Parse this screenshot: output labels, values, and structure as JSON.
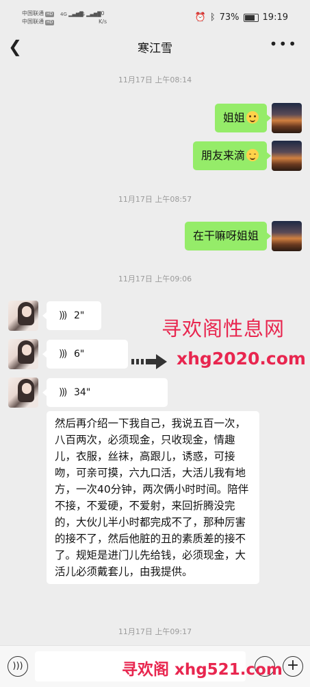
{
  "status_bar": {
    "carrier1": "中国联通",
    "carrier2": "中国联通",
    "hd": "HD",
    "net1": "4G",
    "net2": "5G",
    "speed_value": "0",
    "speed_unit": "K/s",
    "battery": "73%",
    "time": "19:19"
  },
  "header": {
    "title": "寒江雪"
  },
  "timestamps": [
    "11月17日 上午08:14",
    "11月17日 上午08:57",
    "11月17日 上午09:06",
    "11月17日 上午09:17"
  ],
  "messages_out": [
    {
      "text": "姐姐"
    },
    {
      "text": "朋友来滴"
    },
    {
      "text": "在干嘛呀姐姐"
    }
  ],
  "voice_messages": [
    {
      "duration": "2\""
    },
    {
      "duration": "6\""
    },
    {
      "duration": "34\""
    }
  ],
  "long_message": "然后再介绍一下我自己，我说五百一次，八百两次，必须现金，只收现金，情趣儿，衣服，丝袜，高跟儿，诱惑，可接吻，可亲可摸，六九口活，大活儿我有地方，一次40分钟，两次俩小时时间。陪伴不接，不爱硬，不爱射，来回折腾没完的，大伙儿半小时都完成不了，那种厉害的接不了，然后他脏的丑的素质差的接不了。规矩是进门儿先给钱，必须现金，大活儿必须戴套儿，由我提供。",
  "watermarks": {
    "title": "寻欢阁性息网",
    "url": "xhg2020.com",
    "bottom": "寻欢阁 xhg521.com"
  },
  "colors": {
    "accent_bubble": "#95ec69",
    "watermark": "#e8264f",
    "background": "#ededed"
  }
}
